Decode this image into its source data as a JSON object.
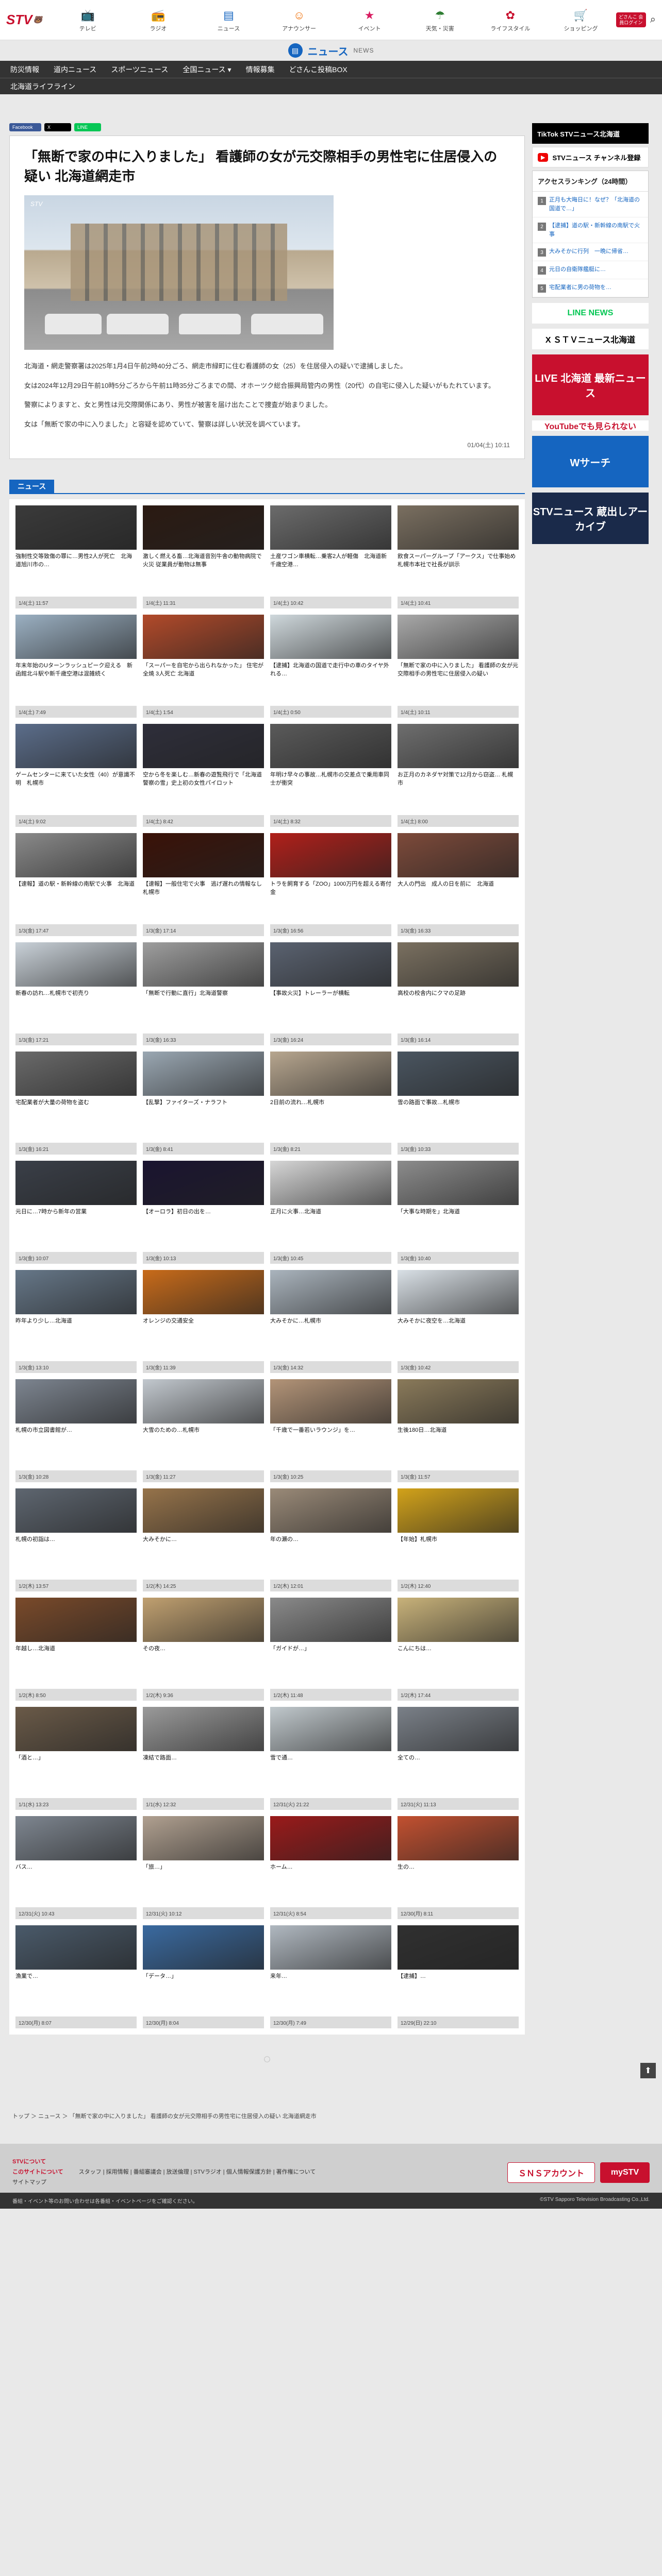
{
  "logo": {
    "text": "STV",
    "sub": "🐻"
  },
  "nav": [
    {
      "label": "テレビ",
      "icon": "tv-icon",
      "glyph": "📺",
      "cls": "blue"
    },
    {
      "label": "ラジオ",
      "icon": "radio-icon",
      "glyph": "📻",
      "cls": "orange"
    },
    {
      "label": "ニュース",
      "icon": "news-icon",
      "glyph": "▤",
      "cls": "active"
    },
    {
      "label": "アナウンサー",
      "icon": "announcer-icon",
      "glyph": "☺",
      "cls": "orange"
    },
    {
      "label": "イベント",
      "icon": "event-icon",
      "glyph": "★",
      "cls": "pink"
    },
    {
      "label": "天気・災害",
      "icon": "weather-icon",
      "glyph": "☂",
      "cls": "green"
    },
    {
      "label": "ライフスタイル",
      "icon": "lifestyle-icon",
      "glyph": "✿",
      "cls": "red"
    },
    {
      "label": "ショッピング",
      "icon": "shopping-icon",
      "glyph": "🛒",
      "cls": "blue"
    }
  ],
  "dosanko_label": "どさんこ\n会員ログイン",
  "newsbar": {
    "title": "ニュース",
    "sub": "NEWS"
  },
  "categories": [
    "防災情報",
    "道内ニュース",
    "スポーツニュース",
    "全国ニュース ▾",
    "情報募集",
    "どさんこ投稿BOX"
  ],
  "category_row2": "北海道ライフライン",
  "share": {
    "fb": "Facebook",
    "x": "X",
    "line": "LINE"
  },
  "article": {
    "title": "「無断で家の中に入りました」 看護師の女が元交際相手の男性宅に住居侵入の疑い 北海道網走市",
    "watermark": "STV",
    "paragraphs": [
      "北海道・網走警察署は2025年1月4日午前2時40分ごろ、網走市緑町に住む看護師の女（25）を住居侵入の疑いで逮捕しました。",
      "女は2024年12月29日午前10時5分ごろから午前11時35分ごろまでの間、オホーツク総合振興局管内の男性（20代）の自宅に侵入した疑いがもたれています。",
      "警察によりますと、女と男性は元交際関係にあり、男性が被害を届け出たことで捜査が始まりました。",
      "女は「無断で家の中に入りました」と容疑を認めていて、警察は詳しい状況を調べています。"
    ],
    "date": "01/04(土) 10:11"
  },
  "section_title": "ニュース",
  "cards": [
    {
      "t": "強制性交等致傷の罪に…男性2人が死亡　北海道旭川市の…",
      "d": "1/4(土) 11:57",
      "c": "#3a3a3a"
    },
    {
      "t": "激しく燃える畜…北海道音別牛舎の動物病院で火災 従業員が動物は無事",
      "d": "1/4(土) 11:31",
      "c": "#2b1a12"
    },
    {
      "t": "土産ワゴン車横転…乗客2人が軽傷　北海道新千歳空港…",
      "d": "1/4(土) 10:42",
      "c": "#6b6b6b"
    },
    {
      "t": "飲食スーパーグループ「アークス」で仕事始め　札幌市本社で社長が訓示",
      "d": "1/4(土) 10:41",
      "c": "#7a6f60"
    },
    {
      "t": "年末年始のUターンラッシュピーク迎える　新函館北斗駅や新千歳空港は混雑続く",
      "d": "1/4(土) 7:49",
      "c": "#9bb0c2"
    },
    {
      "t": "「スーパーを自宅から出られなかった」 住宅が全焼 3人死亡 北海道",
      "d": "1/4(土) 1:54",
      "c": "#b24a2a"
    },
    {
      "t": "【逮捕】北海道の国道で走行中の車のタイヤ外れる…",
      "d": "1/4(土) 0:50",
      "c": "#cfd8dc"
    },
    {
      "t": "「無断で家の中に入りました」 看護師の女が元交際相手の男性宅に住居侵入の疑い",
      "d": "1/4(土) 10:11",
      "c": "#a9a9a9"
    },
    {
      "t": "ゲームセンターに来ていた女性（40）が意識不明　札幌市",
      "d": "1/4(土) 9:02",
      "c": "#5b6d8a"
    },
    {
      "t": "空から冬を楽しむ…新春の遊覧飛行で「北海道警察の雪」史上初の女性パイロット",
      "d": "1/4(土) 8:42",
      "c": "#2e2e3a"
    },
    {
      "t": "年明け早々の事故…札幌市の交差点で乗用車同士が衝突",
      "d": "1/4(土) 8:32",
      "c": "#5a5a5a"
    },
    {
      "t": "お正月のカネダヤ対策で12月から窃盗… 札幌市",
      "d": "1/4(土) 8:00",
      "c": "#6e6e6e"
    },
    {
      "t": "【速報】道の駅・新幹線の南駅で火事　北海道",
      "d": "1/3(金) 17:47",
      "c": "#8a8a8a"
    },
    {
      "t": "【速報】一般住宅で火事　逃げ遅れの情報なし　札幌市",
      "d": "1/3(金) 17:14",
      "c": "#3a1208"
    },
    {
      "t": "トラを飼育する「ZOO」1000万円を超える寄付金",
      "d": "1/3(金) 16:56",
      "c": "#b0201a"
    },
    {
      "t": "大人の門出　成人の日を前に　北海道",
      "d": "1/3(金) 16:33",
      "c": "#7d4a3a"
    },
    {
      "t": "新春の訪れ…札幌市で初売り",
      "d": "1/3(金) 17:21",
      "c": "#c9d1d8"
    },
    {
      "t": "「無断で行動に直行」北海道警察",
      "d": "1/3(金) 16:33",
      "c": "#9e9e9e"
    },
    {
      "t": "【事故火災】トレーラーが横転",
      "d": "1/3(金) 16:24",
      "c": "#5a6270"
    },
    {
      "t": "高校の校舎内にクマの足跡",
      "d": "1/3(金) 16:14",
      "c": "#7a7060"
    },
    {
      "t": "宅配業者が大量の荷物を盗む",
      "d": "1/3(金) 16:21",
      "c": "#6a6a6a"
    },
    {
      "t": "【乱撃】ファイターズ・ナラフト",
      "d": "1/3(金) 8:41",
      "c": "#9aa7b2"
    },
    {
      "t": "2日前の流れ…札幌市",
      "d": "1/3(金) 8:21",
      "c": "#b7a68f"
    },
    {
      "t": "雪の路面で事故…札幌市",
      "d": "1/3(金) 10:33",
      "c": "#4a5560"
    },
    {
      "t": "元日に…7時から新年の営業",
      "d": "1/3(金) 10:07",
      "c": "#3a3f48"
    },
    {
      "t": "【オーロラ】初日の出を…",
      "d": "1/3(金) 10:13",
      "c": "#1a1430"
    },
    {
      "t": "正月に火事…北海道",
      "d": "1/3(金) 10:45",
      "c": "#d6d6d6"
    },
    {
      "t": "「大事な時期を」北海道",
      "d": "1/3(金) 10:40",
      "c": "#8c8c8c"
    },
    {
      "t": "昨年より少し…北海道",
      "d": "1/3(金) 13:10",
      "c": "#667788"
    },
    {
      "t": "オレンジの交通安全",
      "d": "1/3(金) 11:39",
      "c": "#c86b1a"
    },
    {
      "t": "大みそかに…札幌市",
      "d": "1/3(金) 14:32",
      "c": "#aab4bd"
    },
    {
      "t": "大みそかに夜空を…北海道",
      "d": "1/3(金) 10:42",
      "c": "#d9e0e6"
    },
    {
      "t": "札幌の市立図書館が…",
      "d": "1/3(金) 10:28",
      "c": "#7d8590"
    },
    {
      "t": "大雪のための…札幌市",
      "d": "1/3(金) 11:27",
      "c": "#c2c8ce"
    },
    {
      "t": "「千歳で一番若いラウンジ」を…",
      "d": "1/3(金) 10:25",
      "c": "#b39478"
    },
    {
      "t": "生後180日…北海道",
      "d": "1/3(金) 11:57",
      "c": "#8a7a5a"
    },
    {
      "t": "札幌の初詣は…",
      "d": "1/2(木) 13:57",
      "c": "#5e6670"
    },
    {
      "t": "大みそかに…",
      "d": "1/2(木) 14:25",
      "c": "#96734a"
    },
    {
      "t": "年の瀬の…",
      "d": "1/2(木) 12:01",
      "c": "#9a8a78"
    },
    {
      "t": "【年始】札幌市",
      "d": "1/2(木) 12:40",
      "c": "#d2a21a"
    },
    {
      "t": "年越し…北海道",
      "d": "1/2(木) 8:50",
      "c": "#7a4a2a"
    },
    {
      "t": "その夜…",
      "d": "1/2(木) 9:36",
      "c": "#c0a070"
    },
    {
      "t": "「ガイドが…」",
      "d": "1/2(木) 11:48",
      "c": "#8a8a8a"
    },
    {
      "t": "こんにちは…",
      "d": "1/2(木) 17:44",
      "c": "#c8b27a"
    },
    {
      "t": "「酒と…」",
      "d": "1/1(水) 13:23",
      "c": "#6a5a48"
    },
    {
      "t": "凍結で路面…",
      "d": "1/1(水) 12:32",
      "c": "#9a9a9a"
    },
    {
      "t": "雪で通…",
      "d": "12/31(火) 21:22",
      "c": "#c0c8cc"
    },
    {
      "t": "全ての…",
      "d": "12/31(火) 11:13",
      "c": "#7a8088"
    },
    {
      "t": "バス…",
      "d": "12/31(火) 10:43",
      "c": "#7e8690"
    },
    {
      "t": "「旅…」",
      "d": "12/31(火) 10:12",
      "c": "#b0a090"
    },
    {
      "t": "ホーム…",
      "d": "12/31(火) 8:54",
      "c": "#9a1a1a"
    },
    {
      "t": "生の…",
      "d": "12/30(月) 8:11",
      "c": "#c25030"
    },
    {
      "t": "漁業で…",
      "d": "12/30(月) 8:07",
      "c": "#4a5a6a"
    },
    {
      "t": "「データ…」",
      "d": "12/30(月) 8:04",
      "c": "#3a6aa0"
    },
    {
      "t": "来年…",
      "d": "12/30(月) 7:49",
      "c": "#b0b8c0"
    },
    {
      "t": "【逮捕】…",
      "d": "12/29(日) 22:10",
      "c": "#303030"
    }
  ],
  "sidebar": {
    "tiktok": "TikTok  STVニュース北海道",
    "youtube": "STVニュース チャンネル登録",
    "ranking_title": "アクセスランキング（24時間）",
    "ranking": [
      "正月も大晦日に！なぜ？「北海道の国道で…」",
      "【逮捕】道の駅・新幹線の南駅で火事",
      "大みそかに行列　一晩に帰省…",
      "元日の自衛隊艦艇に…",
      "宅配業者に男の荷物を…"
    ],
    "ads": [
      {
        "t": "LINE NEWS",
        "bg": "#ffffff",
        "fg": "#06c755",
        "h": 40
      },
      {
        "t": "X  ＳＴＶニュース北海道",
        "bg": "#ffffff",
        "fg": "#000000",
        "h": 40
      },
      {
        "t": "LIVE 北海道 最新ニュース",
        "bg": "#c8102e",
        "fg": "#ffffff",
        "h": 118
      },
      {
        "t": "YouTubeでも見られない",
        "bg": "#ffffff",
        "fg": "#c8102e",
        "h": 20
      },
      {
        "t": "Wサーチ",
        "bg": "#1565c0",
        "fg": "#ffffff",
        "h": 100
      },
      {
        "t": "STVニュース 蔵出しアーカイブ",
        "bg": "#1a2a4a",
        "fg": "#ffffff",
        "h": 100
      }
    ]
  },
  "breadcrumb": "トップ ＞ ニュース ＞ 「無断で家の中に入りました」 看護師の女が元交際相手の男性宅に住居侵入の疑い 北海道網走市",
  "footer": {
    "left1": "STVについて",
    "left2": "このサイトについて",
    "left3": "サイトマップ",
    "links": "スタッフ | 採用情報 | 番組審議会 | 放送倫理 | STVラジオ | 個人情報保護方針 | 著作権について",
    "sns": "ＳＮＳアカウント",
    "my": "mySTV"
  },
  "copyright_left": "番組・イベント等のお問い合わせは各番組・イベントページをご確認ください。",
  "copyright_right": "©STV Sapporo Television Broadcasting Co.,Ltd."
}
